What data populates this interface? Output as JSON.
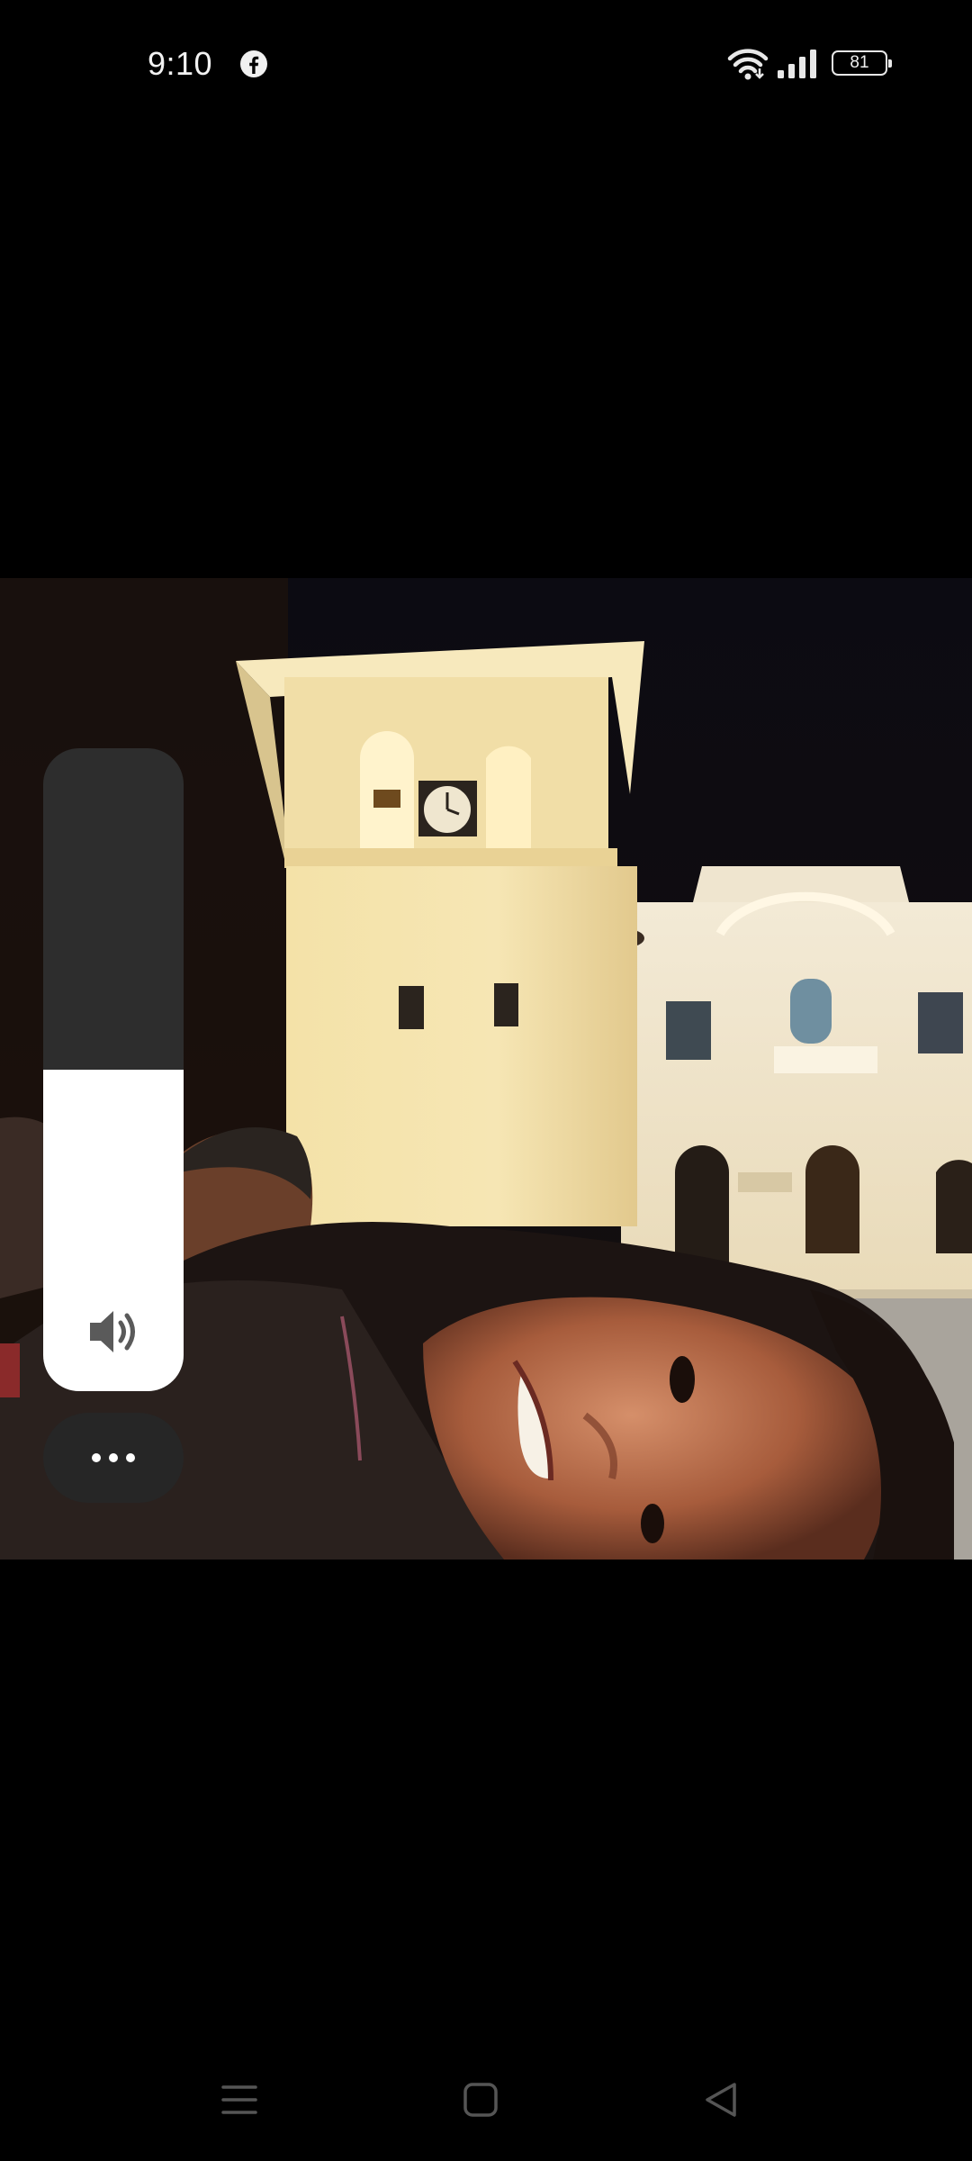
{
  "status_bar": {
    "time": "9:10",
    "notification_icon": "facebook-icon",
    "wifi_icon": "wifi-icon",
    "signal_icon": "cellular-signal-icon",
    "battery_level": "81"
  },
  "photo": {
    "visible_text": ""
  },
  "volume_panel": {
    "level_percent": 50,
    "icon": "speaker-icon",
    "more_icon": "more-horizontal-icon",
    "panel_color": "#2d2d2d",
    "fill_color": "#ffffff"
  },
  "nav_bar": {
    "icons": [
      "menu-icon",
      "home-icon",
      "back-icon"
    ]
  }
}
